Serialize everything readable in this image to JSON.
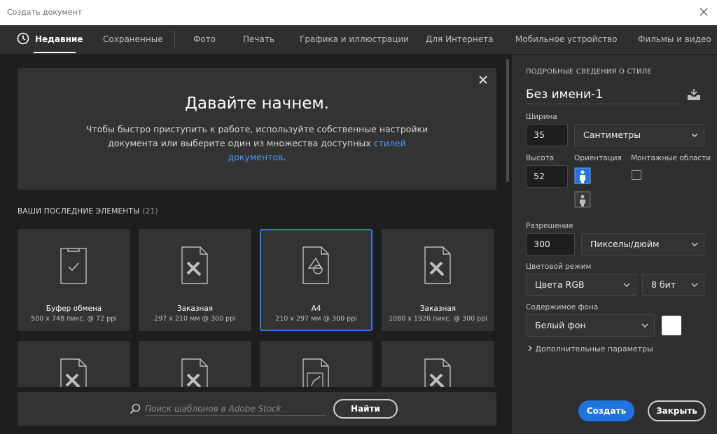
{
  "window": {
    "title": "Создать документ"
  },
  "tabs": [
    {
      "label": "Недавние",
      "active": true
    },
    {
      "label": "Сохраненные"
    },
    {
      "label": "Фото"
    },
    {
      "label": "Печать"
    },
    {
      "label": "Графика и иллюстрации"
    },
    {
      "label": "Для Интернета"
    },
    {
      "label": "Мобильное устройство"
    },
    {
      "label": "Фильмы и видео"
    }
  ],
  "welcome": {
    "heading": "Давайте начнем.",
    "text": "Чтобы быстро приступить к работе, используйте собственные настройки документа или выберите один из множества доступных ",
    "link": "стилей документов",
    "tail": "."
  },
  "recent": {
    "heading": "ВАШИ ПОСЛЕДНИЕ ЭЛЕМЕНТЫ",
    "count": "(21)",
    "items": [
      {
        "name": "Буфер обмена",
        "size": "500 x 748 пикс. @ 72 ppi",
        "icon": "clipboard-icon"
      },
      {
        "name": "Заказная",
        "size": "297 x 210 мм @ 300 ppi",
        "icon": "custom-preset-icon"
      },
      {
        "name": "A4",
        "size": "210 x 297 мм @ 300 ppi",
        "icon": "print-preset-icon",
        "selected": true
      },
      {
        "name": "Заказная",
        "size": "1080 x 1920 пикс. @ 300 ppi",
        "icon": "custom-preset-icon"
      }
    ]
  },
  "search": {
    "placeholder": "Поиск шаблонов в Adobe Stock",
    "button": "Найти"
  },
  "details": {
    "heading": "ПОДРОБНЫЕ СВЕДЕНИЯ О СТИЛЕ",
    "doc_name": "Без имени-1",
    "width_label": "Ширина",
    "width_value": "35",
    "units": "Сантиметры",
    "height_label": "Высота",
    "height_value": "52",
    "orientation_label": "Ориентация",
    "artboards_label": "Монтажные области",
    "resolution_label": "Разрешение",
    "resolution_value": "300",
    "resolution_units": "Пикселы/дюйм",
    "color_mode_label": "Цветовой режим",
    "color_mode": "Цвета RGB",
    "bit_depth": "8 бит",
    "background_label": "Содержимое фона",
    "background": "Белый фон",
    "background_color": "#ffffff",
    "more": "Дополнительные параметры"
  },
  "actions": {
    "create": "Создать",
    "close": "Закрыть"
  },
  "colors": {
    "accent": "#1f73e0",
    "link": "#4d9bff"
  }
}
